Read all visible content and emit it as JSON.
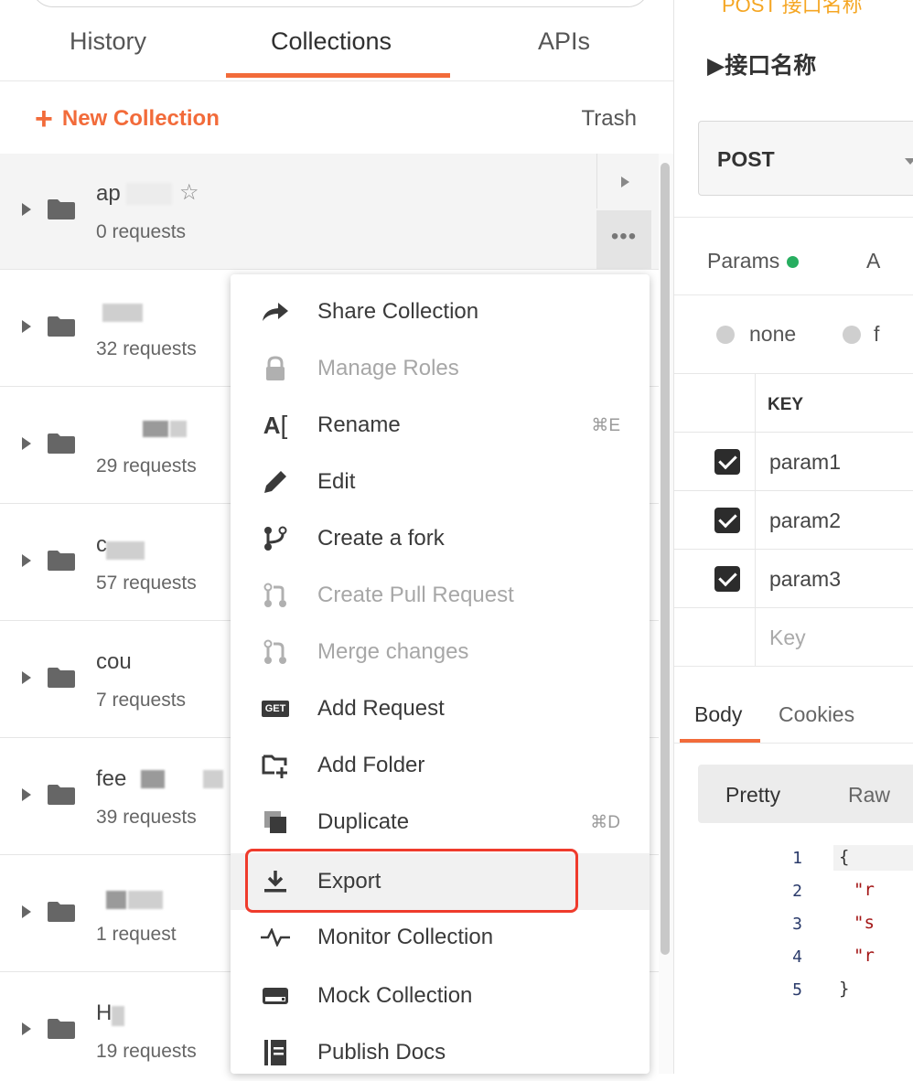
{
  "sidebar": {
    "tabs": [
      {
        "label": "History"
      },
      {
        "label": "Collections"
      },
      {
        "label": "APIs"
      }
    ],
    "new_collection_label": "New Collection",
    "trash_label": "Trash",
    "collections": [
      {
        "name": "ap",
        "count": "0 requests"
      },
      {
        "name": "",
        "count": "32 requests"
      },
      {
        "name": "",
        "count": "29 requests"
      },
      {
        "name": "c",
        "count": "57 requests"
      },
      {
        "name": "cou",
        "count": "7 requests"
      },
      {
        "name": "fee",
        "count": "39 requests"
      },
      {
        "name": "",
        "count": "1 request"
      },
      {
        "name": "H",
        "count": "19 requests"
      }
    ]
  },
  "context_menu": {
    "items": [
      {
        "label": "Share Collection",
        "icon": "share-icon"
      },
      {
        "label": "Manage Roles",
        "icon": "lock-icon",
        "disabled": true
      },
      {
        "label": "Rename",
        "icon": "rename-icon",
        "shortcut": "⌘E"
      },
      {
        "label": "Edit",
        "icon": "pencil-icon"
      },
      {
        "label": "Create a fork",
        "icon": "fork-icon"
      },
      {
        "label": "Create Pull Request",
        "icon": "pull-request-icon",
        "disabled": true
      },
      {
        "label": "Merge changes",
        "icon": "merge-icon",
        "disabled": true
      },
      {
        "label": "Add Request",
        "icon": "get-request-icon",
        "badge": "GET"
      },
      {
        "label": "Add Folder",
        "icon": "add-folder-icon"
      },
      {
        "label": "Duplicate",
        "icon": "duplicate-icon",
        "shortcut": "⌘D"
      },
      {
        "label": "Export",
        "icon": "download-icon",
        "highlighted": true
      },
      {
        "label": "Monitor Collection",
        "icon": "monitor-icon"
      },
      {
        "label": "Mock Collection",
        "icon": "mock-server-icon"
      },
      {
        "label": "Publish Docs",
        "icon": "docs-icon"
      }
    ]
  },
  "request": {
    "tab_label": "POST 接口名称",
    "title": "▶接口名称",
    "method": "POST",
    "params_tab": "Params",
    "auth_tab": "A",
    "body_modes": [
      "none",
      "f"
    ],
    "table_header": "KEY",
    "params": [
      "param1",
      "param2",
      "param3"
    ],
    "key_placeholder": "Key",
    "body_tab": "Body",
    "cookies_tab": "Cookies",
    "format_pretty": "Pretty",
    "format_raw": "Raw",
    "code_lines": [
      {
        "no": "1",
        "text": "{"
      },
      {
        "no": "2",
        "text": "\"r"
      },
      {
        "no": "3",
        "text": "\"s"
      },
      {
        "no": "4",
        "text": "\"r"
      },
      {
        "no": "5",
        "text": "}"
      }
    ]
  },
  "colors": {
    "accent": "#f26b3a",
    "highlight_outline": "#ef3b2c",
    "params_dot": "#27ae60"
  }
}
